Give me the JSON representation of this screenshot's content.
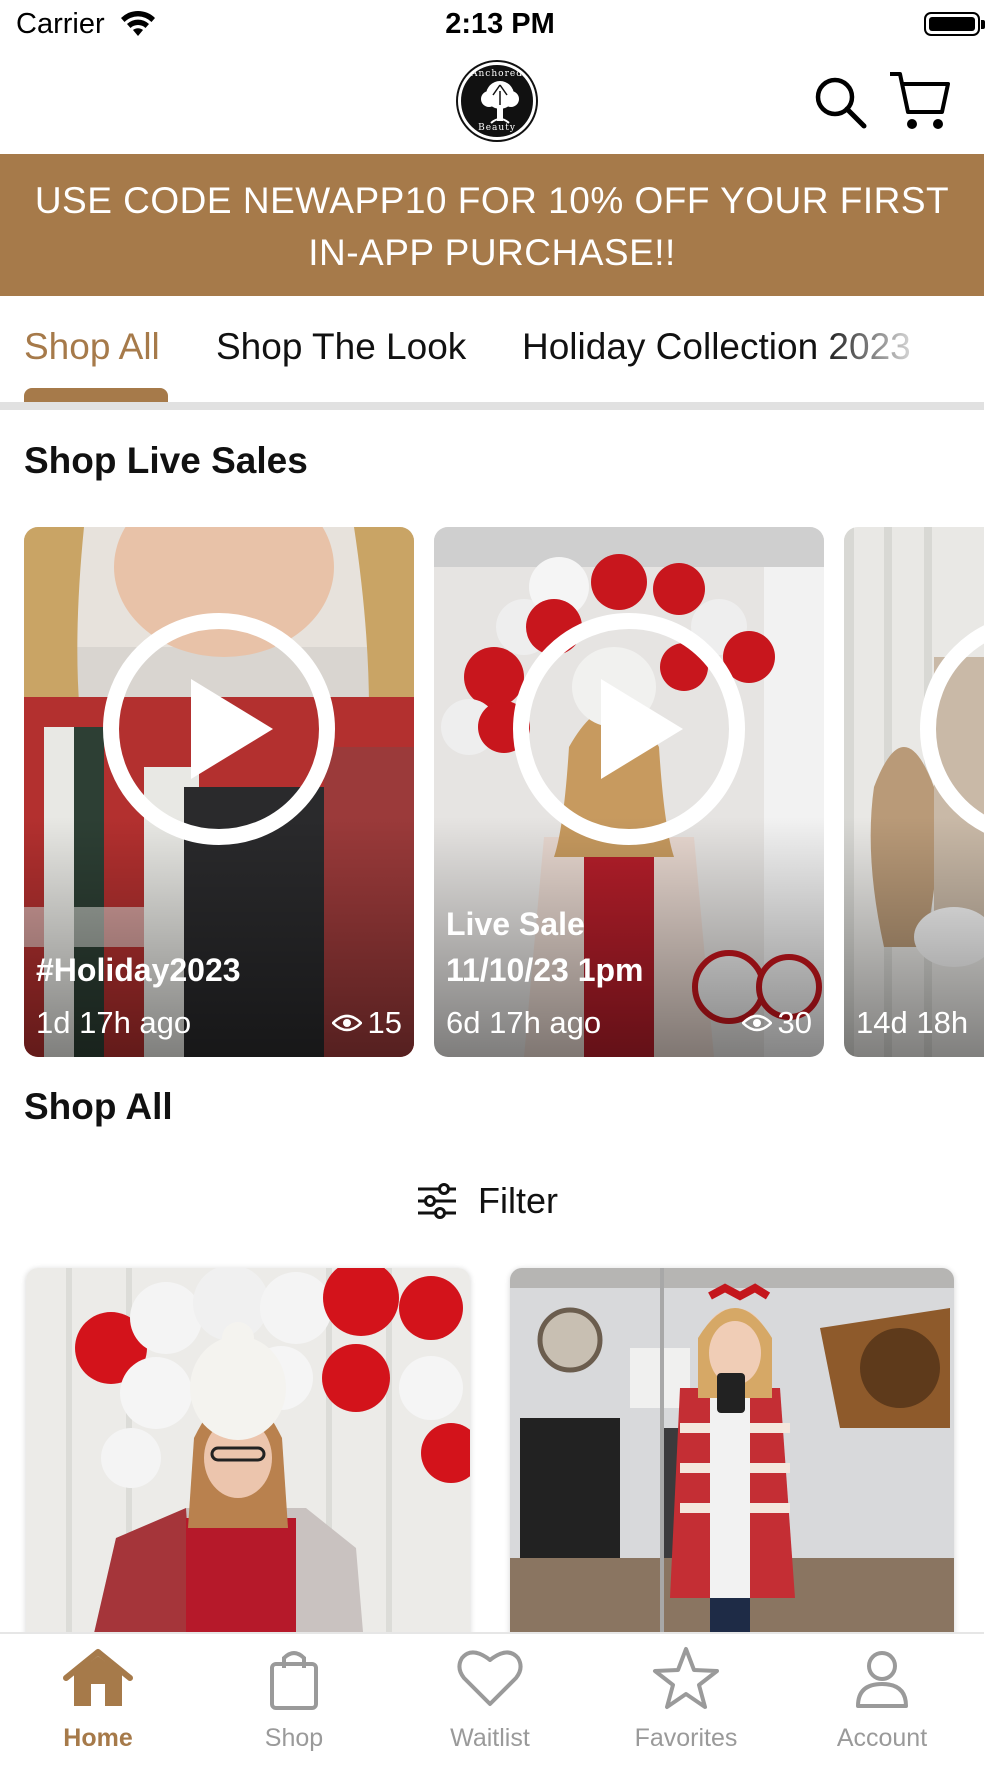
{
  "status_bar": {
    "carrier": "Carrier",
    "time": "2:13 PM"
  },
  "header": {
    "logo_top": "Anchored",
    "logo_bottom": "Beauty",
    "icons": [
      "search-icon",
      "cart-icon"
    ]
  },
  "promo": {
    "text": "USE CODE NEWAPP10 FOR 10% OFF YOUR FIRST IN-APP PURCHASE!!"
  },
  "tabs": [
    {
      "label": "Shop All",
      "active": true
    },
    {
      "label": "Shop The Look",
      "active": false
    },
    {
      "label": "Holiday Collection 2023",
      "active": false
    }
  ],
  "live_sales": {
    "title": "Shop Live Sales",
    "cards": [
      {
        "title": "#Holiday2023",
        "ago": "1d 17h ago",
        "views": "15"
      },
      {
        "title": "Live Sale\n11/10/23 1pm",
        "ago": "6d 17h ago",
        "views": "30"
      },
      {
        "title": "",
        "ago": "14d 18h",
        "views": ""
      }
    ]
  },
  "shop_all": {
    "title": "Shop All",
    "filter_label": "Filter"
  },
  "tabbar": {
    "items": [
      {
        "label": "Home",
        "icon": "home-icon",
        "active": true
      },
      {
        "label": "Shop",
        "icon": "shopping-bag-icon",
        "active": false
      },
      {
        "label": "Waitlist",
        "icon": "heart-icon",
        "active": false
      },
      {
        "label": "Favorites",
        "icon": "star-icon",
        "active": false
      },
      {
        "label": "Account",
        "icon": "person-icon",
        "active": false
      }
    ]
  },
  "colors": {
    "accent": "#a67a4a",
    "inactive": "#9a9a9a",
    "divider": "#e1e1e1"
  }
}
